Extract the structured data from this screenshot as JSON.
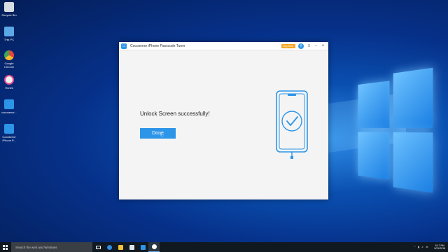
{
  "desktop": {
    "icons": [
      {
        "label": "Recycle Bin",
        "color": "#d8dde3"
      },
      {
        "label": "This PC",
        "color": "#5ca7e6"
      },
      {
        "label": "Google Chrome",
        "color": "#e8453c"
      },
      {
        "label": "iTunes",
        "color": "#f0f0f0"
      },
      {
        "label": "cocosenor...",
        "color": "#2d95e8"
      },
      {
        "label": "Cocosenor iPhone P...",
        "color": "#2d95e8"
      }
    ]
  },
  "window": {
    "title": "Cocosenor iPhone Passcode Tuner",
    "buy_label": "Buy Now",
    "message": "Unlock Screen successfully!",
    "done_label": "Done",
    "accent": "#2d95e8",
    "buy_color": "#f5a623"
  },
  "taskbar": {
    "search_placeholder": "Search the web and Windows",
    "time": "5:17 PM",
    "date": "5/21/2018"
  }
}
